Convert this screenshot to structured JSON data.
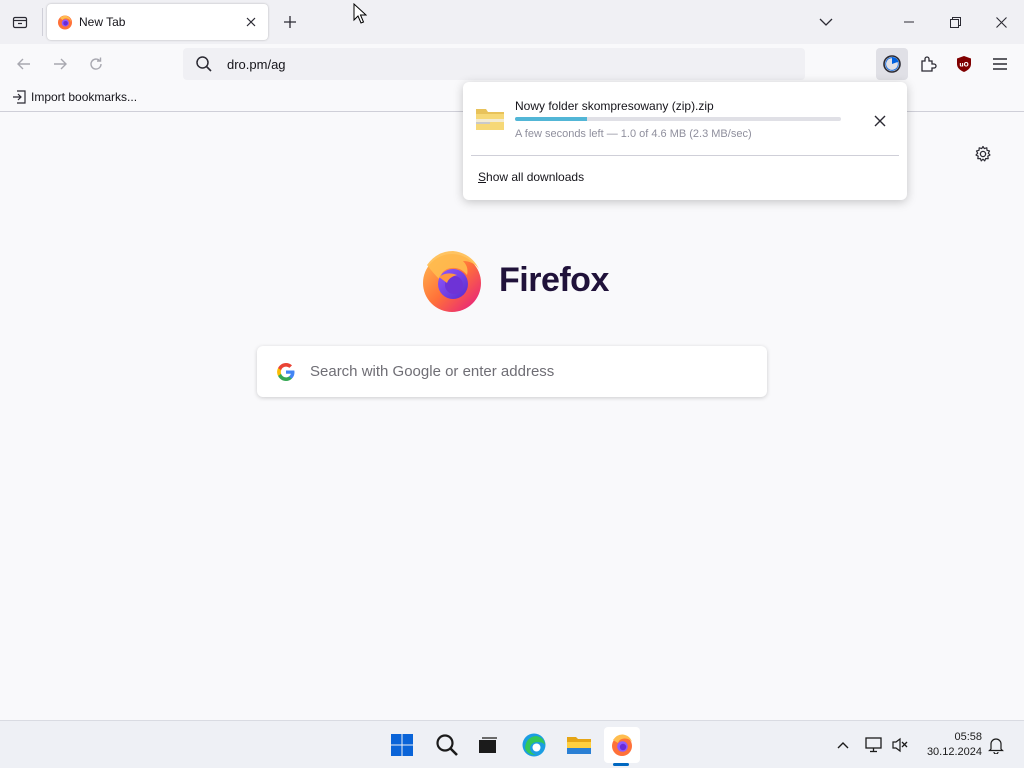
{
  "tabstrip": {
    "tab": {
      "title": "New Tab",
      "favicon": "firefox-icon"
    },
    "icons": {
      "list_all": "list-all-tabs-icon",
      "new_tab": "plus-icon",
      "tabs_menu": "chevron-down-icon"
    },
    "window_controls": [
      "minimize-icon",
      "restore-icon",
      "close-icon"
    ]
  },
  "navbar": {
    "url": "dro.pm/ag",
    "icons": [
      "back-icon",
      "forward-icon",
      "reload-icon",
      "search-icon",
      "downloads-icon",
      "extensions-icon",
      "ublock-icon",
      "menu-icon"
    ]
  },
  "bookmarks": {
    "import_label": "Import bookmarks..."
  },
  "newtab": {
    "brand": "Firefox",
    "search_placeholder": "Search with Google or enter address"
  },
  "downloads": {
    "file_name": "Nowy folder skompresowany (zip).zip",
    "status": "A few seconds left — 1.0 of 4.6 MB (2.3 MB/sec)",
    "progress_fraction": 0.22,
    "show_all_label": "Show all downloads",
    "show_all_access_key": "S",
    "show_all_rest": "how all downloads"
  },
  "taskbar": {
    "apps": [
      "start-icon",
      "search-icon",
      "task-view-icon",
      "edge-icon",
      "file-explorer-icon",
      "firefox-icon"
    ],
    "tray": [
      "chevron-up-icon",
      "network-icon",
      "speaker-muted-icon",
      "notification-icon"
    ],
    "time": "05:58",
    "date": "30.12.2024"
  },
  "colors": {
    "accent": "#0061e0",
    "progress": "#52b6d6",
    "brand_text": "#20123a"
  }
}
